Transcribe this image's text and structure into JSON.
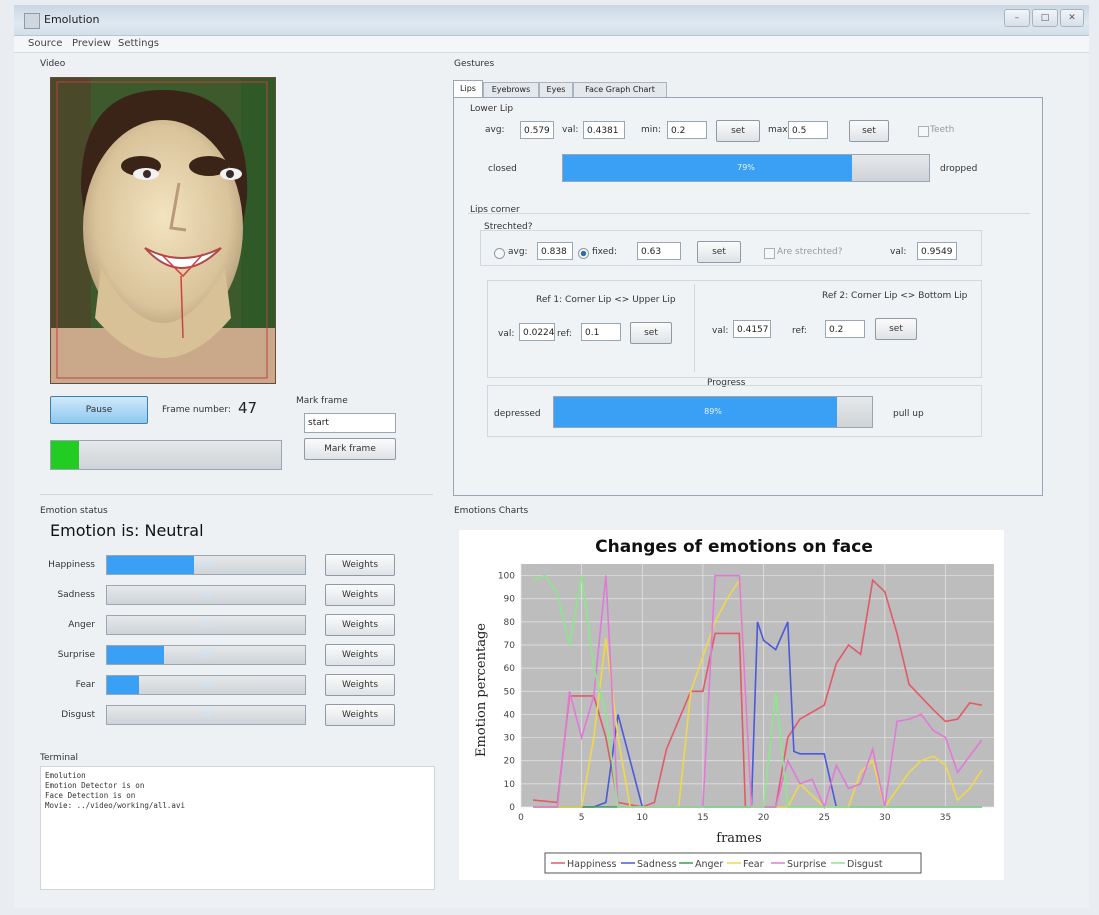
{
  "window": {
    "title": "Emolution",
    "minimize": "–",
    "maximize": "□",
    "close": "✕"
  },
  "menu": [
    "Source",
    "Preview",
    "Settings"
  ],
  "video": {
    "label": "Video",
    "pause_label": "Pause",
    "frame_number_label": "Frame number:",
    "frame_number": "47",
    "mark_frame_label": "Mark frame",
    "mark_frame_value": "start",
    "mark_frame_button": "Mark frame",
    "progress": 0.12,
    "progress_color": "#22cc22"
  },
  "gestures": {
    "label": "Gestures",
    "tabs": [
      "Lips",
      "Eyebrows",
      "Eyes",
      "Face Graph Chart"
    ],
    "lower_lip": {
      "title": "Lower Lip",
      "avg_label": "avg:",
      "avg": "0.579",
      "val_label": "val:",
      "val": "0.4381",
      "min_label": "min:",
      "min": "0.2",
      "set_label": "set",
      "max_label": "max:",
      "max": "0.5",
      "teeth_label": "Teeth",
      "left_label": "closed",
      "right_label": "dropped",
      "progress": 0.79,
      "progress_text": "79%"
    },
    "lips_corner": {
      "title": "Lips corner",
      "stretched_title": "Strechted?",
      "avg_label": "avg:",
      "avg": "0.838",
      "fixed_label": "fixed:",
      "fixed": "0.63",
      "set_label": "set",
      "are_stretched_label": "Are strechted?",
      "val_label": "val:",
      "val": "0.9549",
      "ref1_title": "Ref 1: Corner Lip <> Upper Lip",
      "ref1_val_label": "val:",
      "ref1_val": "0.0224",
      "ref1_ref_label": "ref:",
      "ref1_ref": "0.1",
      "ref2_title": "Ref 2: Corner Lip <> Bottom Lip",
      "ref2_val_label": "val:",
      "ref2_val": "0.4157",
      "ref2_ref_label": "ref:",
      "ref2_ref": "0.2",
      "progress_title": "Progress",
      "left_label": "depressed",
      "right_label": "pull up",
      "progress": 0.89,
      "progress_text": "89%"
    }
  },
  "emotion_status": {
    "label": "Emotion status",
    "headline": "Emotion is: Neutral",
    "weights_label": "Weights",
    "rows": [
      {
        "name": "Happiness",
        "value": 0.44,
        "text": "44%"
      },
      {
        "name": "Sadness",
        "value": 0.0,
        "text": "0%"
      },
      {
        "name": "Anger",
        "value": 0.0,
        "text": "0%"
      },
      {
        "name": "Surprise",
        "value": 0.29,
        "text": "29%"
      },
      {
        "name": "Fear",
        "value": 0.16,
        "text": "16%"
      },
      {
        "name": "Disgust",
        "value": 0.0,
        "text": "0%"
      }
    ]
  },
  "terminal": {
    "label": "Terminal",
    "lines": [
      "Emolution",
      "Emotion Detector is on",
      "Face Detection is on",
      "Movie: ../video/working/all.avi"
    ]
  },
  "charts_label": "Emotions Charts",
  "chart_data": {
    "type": "line",
    "title": "Changes of emotions on face",
    "xlabel": "frames",
    "ylabel": "Emotion percentage",
    "xlim": [
      0,
      39
    ],
    "ylim": [
      0,
      105
    ],
    "xticks": [
      0,
      5,
      10,
      15,
      20,
      25,
      30,
      35
    ],
    "yticks": [
      0,
      10,
      20,
      30,
      40,
      50,
      60,
      70,
      80,
      90,
      100
    ],
    "grid": true,
    "legend_position": "bottom",
    "series": [
      {
        "name": "Happiness",
        "color": "#e05a6a",
        "points": [
          [
            1,
            3
          ],
          [
            3,
            2
          ],
          [
            4,
            48
          ],
          [
            6,
            48
          ],
          [
            7,
            30
          ],
          [
            8,
            2
          ],
          [
            10,
            0
          ],
          [
            11,
            2
          ],
          [
            12,
            25
          ],
          [
            14,
            50
          ],
          [
            15,
            50
          ],
          [
            16,
            75
          ],
          [
            18,
            75
          ],
          [
            18.5,
            0
          ],
          [
            21,
            0
          ],
          [
            22,
            30
          ],
          [
            23,
            38
          ],
          [
            25,
            44
          ],
          [
            26,
            62
          ],
          [
            27,
            70
          ],
          [
            28,
            66
          ],
          [
            29,
            98
          ],
          [
            30,
            93
          ],
          [
            31,
            75
          ],
          [
            32,
            53
          ],
          [
            34,
            42
          ],
          [
            35,
            37
          ],
          [
            36,
            38
          ],
          [
            37,
            45
          ],
          [
            38,
            44
          ]
        ]
      },
      {
        "name": "Sadness",
        "color": "#4a5ad8",
        "points": [
          [
            1,
            0
          ],
          [
            6,
            0
          ],
          [
            7,
            2
          ],
          [
            8,
            40
          ],
          [
            9,
            20
          ],
          [
            10,
            0
          ],
          [
            19,
            0
          ],
          [
            19.5,
            80
          ],
          [
            20,
            72
          ],
          [
            21,
            68
          ],
          [
            22,
            80
          ],
          [
            22.5,
            24
          ],
          [
            23,
            23
          ],
          [
            25,
            23
          ],
          [
            26,
            0
          ],
          [
            38,
            0
          ]
        ]
      },
      {
        "name": "Anger",
        "color": "#3aa04a",
        "points": [
          [
            1,
            0
          ],
          [
            38,
            0
          ]
        ]
      },
      {
        "name": "Fear",
        "color": "#f0d84a",
        "points": [
          [
            1,
            0
          ],
          [
            5,
            0
          ],
          [
            6,
            30
          ],
          [
            7,
            73
          ],
          [
            8,
            30
          ],
          [
            9,
            0
          ],
          [
            13,
            0
          ],
          [
            14,
            50
          ],
          [
            15,
            65
          ],
          [
            16,
            80
          ],
          [
            17,
            90
          ],
          [
            18,
            98
          ],
          [
            19,
            0
          ],
          [
            22,
            0
          ],
          [
            23,
            10
          ],
          [
            25,
            0
          ],
          [
            27,
            0
          ],
          [
            28,
            15
          ],
          [
            29,
            20
          ],
          [
            30,
            0
          ],
          [
            32,
            15
          ],
          [
            33,
            20
          ],
          [
            34,
            22
          ],
          [
            35,
            18
          ],
          [
            36,
            3
          ],
          [
            37,
            8
          ],
          [
            38,
            16
          ]
        ]
      },
      {
        "name": "Surprise",
        "color": "#e07ad8",
        "points": [
          [
            1,
            0
          ],
          [
            3,
            0
          ],
          [
            4,
            50
          ],
          [
            5,
            30
          ],
          [
            6,
            48
          ],
          [
            7,
            100
          ],
          [
            8,
            0
          ],
          [
            15,
            0
          ],
          [
            16,
            100
          ],
          [
            18,
            100
          ],
          [
            19,
            0
          ],
          [
            21,
            0
          ],
          [
            22,
            20
          ],
          [
            23,
            10
          ],
          [
            24,
            12
          ],
          [
            25,
            0
          ],
          [
            26,
            18
          ],
          [
            27,
            8
          ],
          [
            28,
            10
          ],
          [
            29,
            25
          ],
          [
            30,
            0
          ],
          [
            31,
            37
          ],
          [
            32,
            38
          ],
          [
            33,
            40
          ],
          [
            34,
            33
          ],
          [
            35,
            30
          ],
          [
            36,
            15
          ],
          [
            37,
            22
          ],
          [
            38,
            29
          ]
        ]
      },
      {
        "name": "Disgust",
        "color": "#8ae88a",
        "points": [
          [
            1,
            98
          ],
          [
            2,
            100
          ],
          [
            3,
            92
          ],
          [
            4,
            70
          ],
          [
            5,
            100
          ],
          [
            6,
            60
          ],
          [
            7,
            40
          ],
          [
            8,
            0
          ],
          [
            20,
            0
          ],
          [
            21,
            50
          ],
          [
            22,
            0
          ],
          [
            38,
            0
          ]
        ]
      }
    ]
  }
}
